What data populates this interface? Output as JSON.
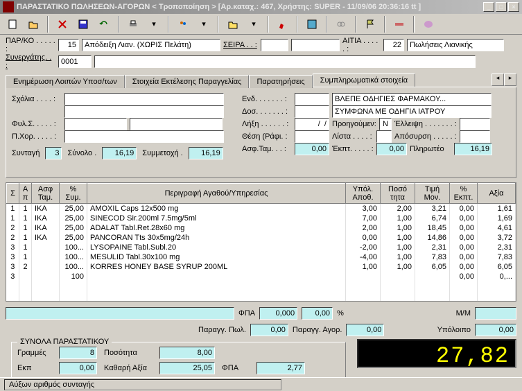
{
  "title": "ΠΑΡΑΣΤΑΤΙΚΟ ΠΩΛΗΣΕΩΝ-ΑΓΟΡΩΝ < Τροποποίηση > [Αρ.καταχ.: 467, Χρήστης: SUPER - 11/09/06 20:36:16 tt ]",
  "header": {
    "parko_lbl": "ΠΑΡ/ΚΟ . . . . . :",
    "parko_num": "15",
    "parko_desc": "Απόδειξη Λιαν. (ΧΩΡΙΣ Πελάτη)",
    "seira_lbl": "ΣΕΙΡΑ . . :",
    "seira_val": "",
    "seira_desc": "",
    "aitia_lbl": "ΑΙΤΙΑ . . . . . :",
    "aitia_num": "22",
    "aitia_desc": "Πωλήσεις Λιανικής",
    "synerg_lbl": "Συνεργάτης. . :",
    "synerg_code": "0001",
    "synerg_desc": ""
  },
  "tabs": {
    "t1": "Ενημέρωση Λοιπών Υποσ/των",
    "t2": "Στοιχεία Εκτέλεσης Παραγγελίας",
    "t3": "Παρατηρήσεις",
    "t4": "Συμπληρωματικά στοιχεία"
  },
  "panel": {
    "sxolia_lbl": "Σχόλια . . . . :",
    "fyls_lbl": "Φυλ.Σ. . . . . :",
    "pxor_lbl": "Π.Χορ. . . . . :",
    "end_lbl": "Ενδ. . . . . . . :",
    "end_text": "ΒΛΕΠΕ ΟΔΗΓΙΕΣ ΦΑΡΜΑΚΟΥ...",
    "dos_lbl": "Δοσ. . . . . . . :",
    "dos_text": "ΣΥΜΦΩΝΑ ΜΕ ΟΔΗΓΙΑ ΙΑΤΡΟΥ",
    "lixi_lbl": "Λήξη . . . . . . :",
    "lixi_val": "  /  /",
    "proig_lbl": "Προηγούμεν:",
    "proig_val": "Ν",
    "elleipsi_lbl": "Έλλειψη . . . . . . . :",
    "thesi_lbl": "Θέση (Ράφι. :",
    "lista_lbl": "Λίστα . . . . :",
    "aposyrsi_lbl": "Απόσυρση . . . . . :",
    "asftam_lbl": "Ασφ.Ταμ. . . :",
    "asftam_val": "0,00",
    "ekpt_lbl": "Έκπτ. . . . . :",
    "ekpt_val": "0,00",
    "plir_lbl": "Πληρωτέο",
    "plir_val": "16,19",
    "syntagi_lbl": "Συνταγή",
    "syntagi_val": "3",
    "synolo_lbl": "Σύνολο .",
    "synolo_val": "16,19",
    "symm_lbl": "Συμμετοχή .",
    "symm_val": "16,19"
  },
  "grid": {
    "headers": {
      "s": "Σ",
      "a": "Α\nπ",
      "asf": "Ασφ\nΤαμ.",
      "pct": "%\nΣυμ.",
      "desc": "Περιγραφή\nΑγαθού/Υπηρεσίας",
      "ypol": "Υπόλ.\nΑποθ.",
      "poso": "Ποσό\nτητα",
      "timi": "Τιμή\nΜον.",
      "ekpt": "%\nΕκπτ.",
      "axia": "Αξία"
    },
    "rows": [
      {
        "s": "1",
        "a": "1",
        "asf": "IKA",
        "pct": "25,00",
        "desc": "AMOXIL Caps 12x500 mg",
        "ypol": "3,00",
        "poso": "2,00",
        "timi": "3,21",
        "ekpt": "0,00",
        "axia": "1,61"
      },
      {
        "s": "1",
        "a": "1",
        "asf": "IKA",
        "pct": "25,00",
        "desc": "SINECOD Sir.200ml 7.5mg/5ml",
        "ypol": "7,00",
        "poso": "1,00",
        "timi": "6,74",
        "ekpt": "0,00",
        "axia": "1,69"
      },
      {
        "s": "2",
        "a": "1",
        "asf": "IKA",
        "pct": "25,00",
        "desc": "ADALAT Tabl.Ret.28x60 mg",
        "ypol": "2,00",
        "poso": "1,00",
        "timi": "18,45",
        "ekpt": "0,00",
        "axia": "4,61"
      },
      {
        "s": "2",
        "a": "1",
        "asf": "IKA",
        "pct": "25,00",
        "desc": "PANCORAN Tts 30x5mg/24h",
        "ypol": "0,00",
        "poso": "1,00",
        "timi": "14,86",
        "ekpt": "0,00",
        "axia": "3,72"
      },
      {
        "s": "3",
        "a": "1",
        "asf": "",
        "pct": "100...",
        "desc": "LYSOPAINE Tabl.Subl.20",
        "ypol": "-2,00",
        "poso": "1,00",
        "timi": "2,31",
        "ekpt": "0,00",
        "axia": "2,31"
      },
      {
        "s": "3",
        "a": "1",
        "asf": "",
        "pct": "100...",
        "desc": "MESULID Tabl.30x100 mg",
        "ypol": "-4,00",
        "poso": "1,00",
        "timi": "7,83",
        "ekpt": "0,00",
        "axia": "7,83"
      },
      {
        "s": "3",
        "a": "2",
        "asf": "",
        "pct": "100...",
        "desc": "KORRES HONEY BASE SYRUP 200ML",
        "ypol": "1,00",
        "poso": "1,00",
        "timi": "6,05",
        "ekpt": "0,00",
        "axia": "6,05"
      },
      {
        "s": "3",
        "a": "",
        "asf": "",
        "pct": "100",
        "desc": "",
        "ypol": "",
        "poso": "",
        "timi": "",
        "ekpt": "0,00",
        "axia": "0,..."
      }
    ]
  },
  "midsummary": {
    "fpa_lbl": "ΦΠΑ",
    "fpa_val": "0,000",
    "fpa_pct": "0,00",
    "pct_sym": "%",
    "mm_lbl": "Μ/Μ",
    "mm_val": "",
    "parpol_lbl": "Παραγγ. Πωλ.",
    "parpol_val": "0,00",
    "paragor_lbl": "Παραγγ. Αγορ.",
    "paragor_val": "0,00",
    "ypol_lbl": "Υπόλοιπο",
    "ypol_val": "0,00"
  },
  "totals": {
    "title": "ΣΥΝΟΛΑ ΠΑΡΑΣΤΑΤΙΚΟΥ",
    "grammes_lbl": "Γραμμές",
    "grammes_val": "8",
    "posotita_lbl": "Ποσότητα",
    "posotita_val": "8,00",
    "ekp_lbl": "Εκπ",
    "ekp_val": "0,00",
    "kathaxia_lbl": "Καθαρή Αξία",
    "kathaxia_val": "25,05",
    "fpa_lbl": "ΦΠΑ",
    "fpa_val": "2,77",
    "lcd": "27,82"
  },
  "status": "Αύξων αριθμός συνταγής"
}
